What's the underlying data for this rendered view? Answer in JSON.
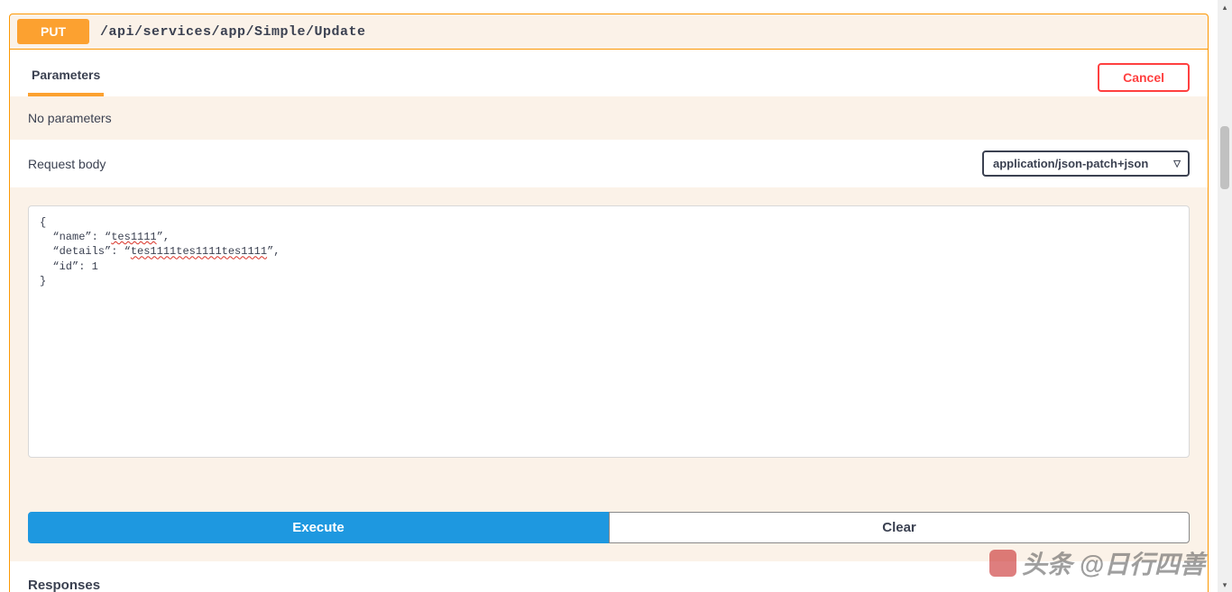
{
  "endpoint": {
    "method": "PUT",
    "path": "/api/services/app/Simple/Update"
  },
  "tabs": {
    "parameters_label": "Parameters"
  },
  "buttons": {
    "cancel": "Cancel",
    "execute": "Execute",
    "clear": "Clear"
  },
  "parameters": {
    "empty_message": "No parameters"
  },
  "request_body": {
    "label": "Request body",
    "content_type": "application/json-patch+json",
    "value": "{\n  \"name\": \"tes1111\",\n  \"details\": \"tes1111tes1111tes1111\",\n  \"id\": 1\n}"
  },
  "sections": {
    "responses": "Responses"
  },
  "watermark": "头条 @日行四善"
}
